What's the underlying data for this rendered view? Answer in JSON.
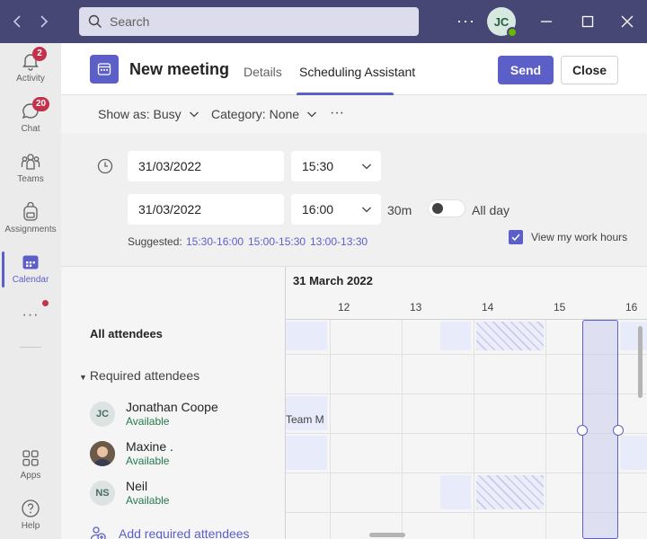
{
  "titlebar": {
    "back_icon": "chevron-left-icon",
    "forward_icon": "chevron-right-icon",
    "search_placeholder": "Search",
    "more": "···",
    "avatar_initials": "JC",
    "presence": "available",
    "colors": {
      "background": "#464775"
    }
  },
  "rail": {
    "items": [
      {
        "label": "Activity",
        "icon": "bell-icon",
        "badge": "2"
      },
      {
        "label": "Chat",
        "icon": "chat-icon",
        "badge": "20"
      },
      {
        "label": "Teams",
        "icon": "teams-icon"
      },
      {
        "label": "Assignments",
        "icon": "backpack-icon"
      },
      {
        "label": "Calendar",
        "icon": "calendar-icon",
        "active": true
      },
      {
        "label": "···",
        "icon": "more-icon"
      },
      {
        "label": "Apps",
        "icon": "apps-icon"
      },
      {
        "label": "Help",
        "icon": "help-icon"
      }
    ]
  },
  "header": {
    "title": "New meeting",
    "tabs": [
      {
        "label": "Details",
        "active": false
      },
      {
        "label": "Scheduling Assistant",
        "active": true
      }
    ],
    "send_label": "Send",
    "close_label": "Close",
    "accent": "#5b5fc7"
  },
  "toolbar": {
    "show_as": "Show as: Busy",
    "category": "Category: None",
    "more": "···"
  },
  "form": {
    "start_date": "31/03/2022",
    "start_time": "15:30",
    "end_date": "31/03/2022",
    "end_time": "16:00",
    "duration": "30m",
    "all_day_label": "All day",
    "all_day_on": false,
    "suggested_label": "Suggested:",
    "suggestions": [
      "15:30-16:00",
      "15:00-15:30",
      "13:00-13:30"
    ],
    "work_hours_label": "View my work hours",
    "work_hours_checked": true
  },
  "scheduler": {
    "date": "31 March 2022",
    "hours": [
      "12",
      "13",
      "14",
      "15",
      "16"
    ],
    "all_attendees_label": "All attendees",
    "required_label": "Required attendees",
    "attendees": [
      {
        "name": "Jonathan Coope",
        "initials": "JC",
        "status": "Available"
      },
      {
        "name": "Maxine .",
        "initials": "",
        "status": "Available",
        "photo": true
      },
      {
        "name": "Neil",
        "initials": "NS",
        "status": "Available"
      }
    ],
    "event_label": "Team M",
    "add_required_label": "Add required attendees"
  }
}
